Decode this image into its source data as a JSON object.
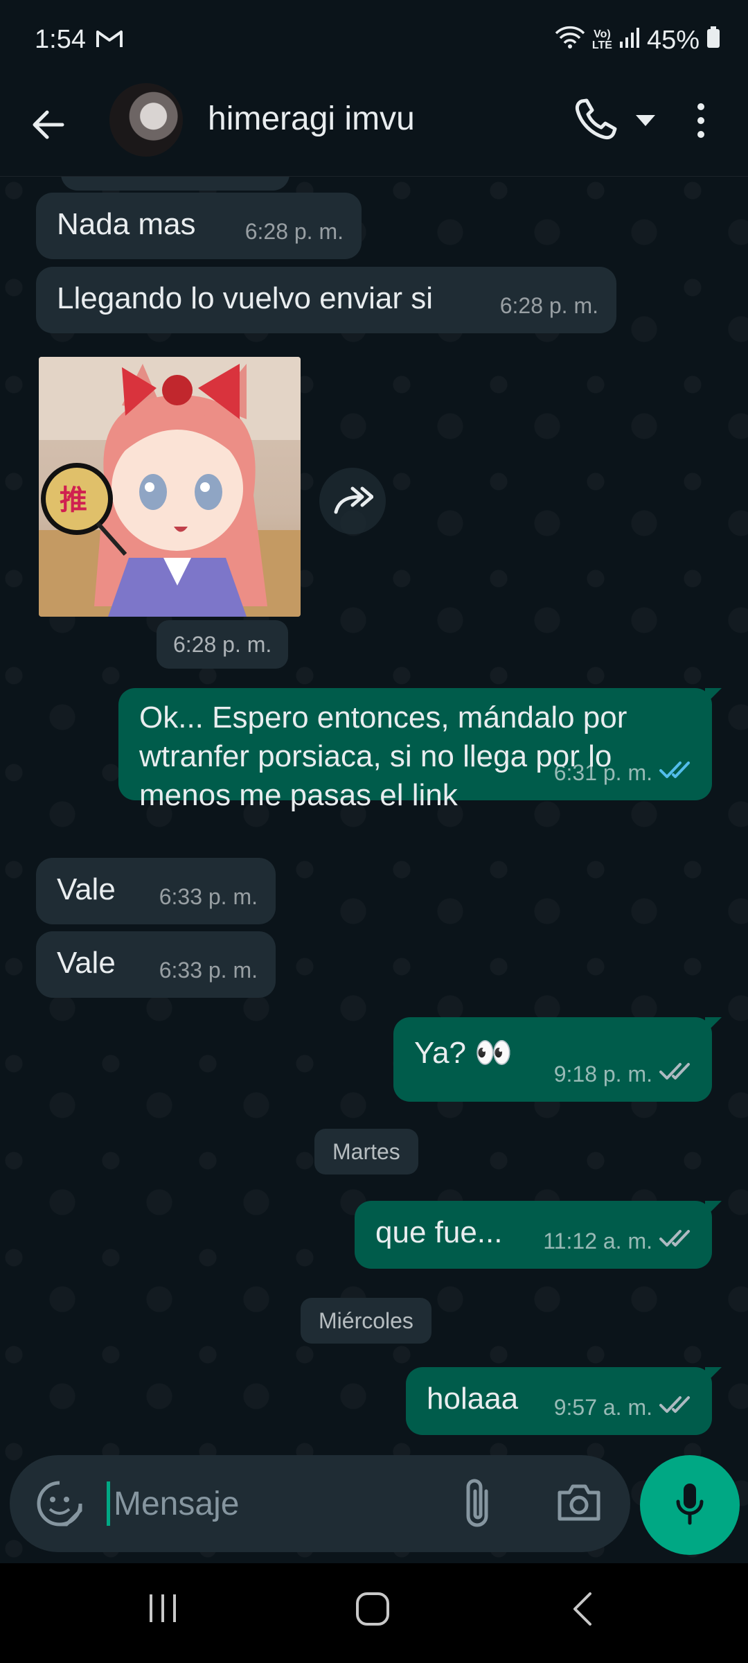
{
  "status_bar": {
    "time": "1:54",
    "battery": "45%",
    "volte_top": "Vo)",
    "volte_bottom": "LTE"
  },
  "header": {
    "contact_name": "himeragi imvu"
  },
  "messages": [
    {
      "direction": "in",
      "text": "Nada mas",
      "time": "6:28 p. m."
    },
    {
      "direction": "in",
      "text": "Llegando lo vuelvo enviar si",
      "time": "6:28 p. m."
    },
    {
      "direction": "in",
      "type": "sticker",
      "sticker_text": "推",
      "time": "6:28 p. m."
    },
    {
      "direction": "out",
      "text": "Ok... Espero entonces, mándalo por wtranfer porsiaca, si no llega por lo menos me pasas el link",
      "time": "6:31 p. m.",
      "status": "read"
    },
    {
      "direction": "in",
      "text": "Vale",
      "time": "6:33 p. m."
    },
    {
      "direction": "in",
      "text": "Vale",
      "time": "6:33 p. m."
    },
    {
      "direction": "out",
      "text": "Ya? 👀",
      "time": "9:18 p. m.",
      "status": "delivered"
    },
    {
      "direction": "out",
      "text": "que fue...",
      "time": "11:12 a. m.",
      "status": "delivered"
    },
    {
      "direction": "out",
      "text": "holaaa",
      "time": "9:57 a. m.",
      "status": "delivered"
    }
  ],
  "date_separators": [
    "Martes",
    "Miércoles"
  ],
  "composer": {
    "placeholder": "Mensaje"
  },
  "colors": {
    "background": "#0b141a",
    "incoming": "#1f2c34",
    "outgoing": "#005c4b",
    "accent": "#00a884",
    "read_ticks": "#53bdeb"
  }
}
